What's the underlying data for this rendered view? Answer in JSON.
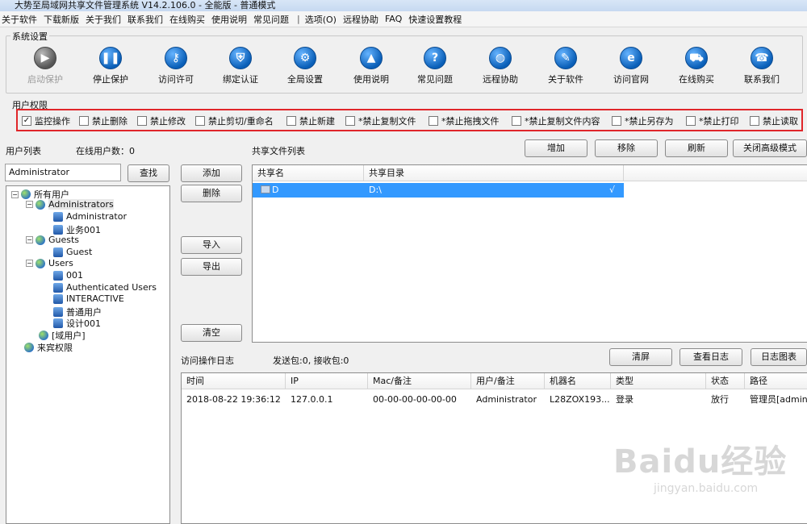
{
  "window": {
    "title": "大势至局域网共享文件管理系统 V14.2.106.0 - 全能版 - 普通模式"
  },
  "menu": {
    "items": [
      "关于软件",
      "下载新版",
      "关于我们",
      "联系我们",
      "在线购买",
      "使用说明",
      "常见问题"
    ],
    "separator": "|",
    "items2": [
      "选项(O)",
      "远程协助",
      "FAQ",
      "快速设置教程"
    ]
  },
  "system_settings": {
    "label": "系统设置",
    "buttons": [
      {
        "label": "启动保护",
        "icon": "play-icon",
        "enabled": false
      },
      {
        "label": "停止保护",
        "icon": "pause-icon",
        "enabled": true
      },
      {
        "label": "访问许可",
        "icon": "key-icon",
        "enabled": true
      },
      {
        "label": "绑定认证",
        "icon": "shield-icon",
        "enabled": true
      },
      {
        "label": "全局设置",
        "icon": "gear-icon",
        "enabled": true
      },
      {
        "label": "使用说明",
        "icon": "graduation-cap-icon",
        "enabled": true
      },
      {
        "label": "常见问题",
        "icon": "question-icon",
        "enabled": true
      },
      {
        "label": "远程协助",
        "icon": "globe-icon",
        "enabled": true
      },
      {
        "label": "关于软件",
        "icon": "notepad-icon",
        "enabled": true
      },
      {
        "label": "访问官网",
        "icon": "ie-icon",
        "enabled": true
      },
      {
        "label": "在线购买",
        "icon": "cart-icon",
        "enabled": true
      },
      {
        "label": "联系我们",
        "icon": "phone-icon",
        "enabled": true
      }
    ]
  },
  "user_permissions": {
    "label": "用户权限",
    "items": [
      {
        "label": "监控操作",
        "checked": true
      },
      {
        "label": "禁止删除",
        "checked": false
      },
      {
        "label": "禁止修改",
        "checked": false
      },
      {
        "label": "禁止剪切/重命名",
        "checked": false
      },
      {
        "label": "禁止新建",
        "checked": false
      },
      {
        "label": "*禁止复制文件",
        "checked": false
      },
      {
        "label": "*禁止拖拽文件",
        "checked": false
      },
      {
        "label": "*禁止复制文件内容",
        "checked": false
      },
      {
        "label": "*禁止另存为",
        "checked": false
      },
      {
        "label": "*禁止打印",
        "checked": false
      },
      {
        "label": "禁止读取",
        "checked": false
      }
    ],
    "highlight_color": "#e0262a"
  },
  "user_list": {
    "label": "用户列表",
    "online_label": "在线用户数：0",
    "search_value": "Administrator",
    "search_button": "查找",
    "tree": [
      {
        "label": "所有用户",
        "level": 0,
        "icon": "globe",
        "expander": "−"
      },
      {
        "label": "Administrators",
        "level": 1,
        "icon": "globe",
        "expander": "−",
        "selected": true
      },
      {
        "label": "Administrator",
        "level": 2,
        "icon": "user"
      },
      {
        "label": "业务001",
        "level": 2,
        "icon": "user"
      },
      {
        "label": "Guests",
        "level": 1,
        "icon": "globe",
        "expander": "−"
      },
      {
        "label": "Guest",
        "level": 2,
        "icon": "user"
      },
      {
        "label": "Users",
        "level": 1,
        "icon": "globe",
        "expander": "−"
      },
      {
        "label": "001",
        "level": 2,
        "icon": "user"
      },
      {
        "label": "Authenticated Users",
        "level": 2,
        "icon": "user"
      },
      {
        "label": "INTERACTIVE",
        "level": 2,
        "icon": "user"
      },
      {
        "label": "普通用户",
        "level": 2,
        "icon": "user"
      },
      {
        "label": "设计001",
        "level": 2,
        "icon": "user"
      },
      {
        "label": "[域用户]",
        "level": 1,
        "icon": "globe"
      },
      {
        "label": "来宾权限",
        "level": 0,
        "icon": "globe"
      }
    ]
  },
  "middle_buttons": {
    "add": "添加",
    "delete": "删除",
    "import": "导入",
    "export": "导出",
    "clear": "清空"
  },
  "share_list": {
    "label": "共享文件列表",
    "buttons": [
      "增加",
      "移除",
      "刷新",
      "关闭高级模式"
    ],
    "columns": [
      "共享名",
      "共享目录"
    ],
    "rows": [
      {
        "name": "D",
        "path": "D:\\",
        "flag": "√",
        "selected": true
      }
    ],
    "selection_color": "#3399ff"
  },
  "access_log": {
    "label": "访问操作日志",
    "stats": "发送包:0, 接收包:0",
    "buttons": [
      "清屏",
      "查看日志",
      "日志图表"
    ],
    "columns": [
      "时间",
      "IP",
      "Mac/备注",
      "用户/备注",
      "机器名",
      "类型",
      "状态",
      "路径"
    ],
    "rows": [
      [
        "2018-08-22 19:36:12",
        "127.0.0.1",
        "00-00-00-00-00-00",
        "Administrator",
        "L28ZOX193...",
        "登录",
        "放行",
        "管理员[admin]"
      ]
    ]
  },
  "watermark": {
    "brand": "Baidu经验",
    "url": "jingyan.baidu.com"
  }
}
